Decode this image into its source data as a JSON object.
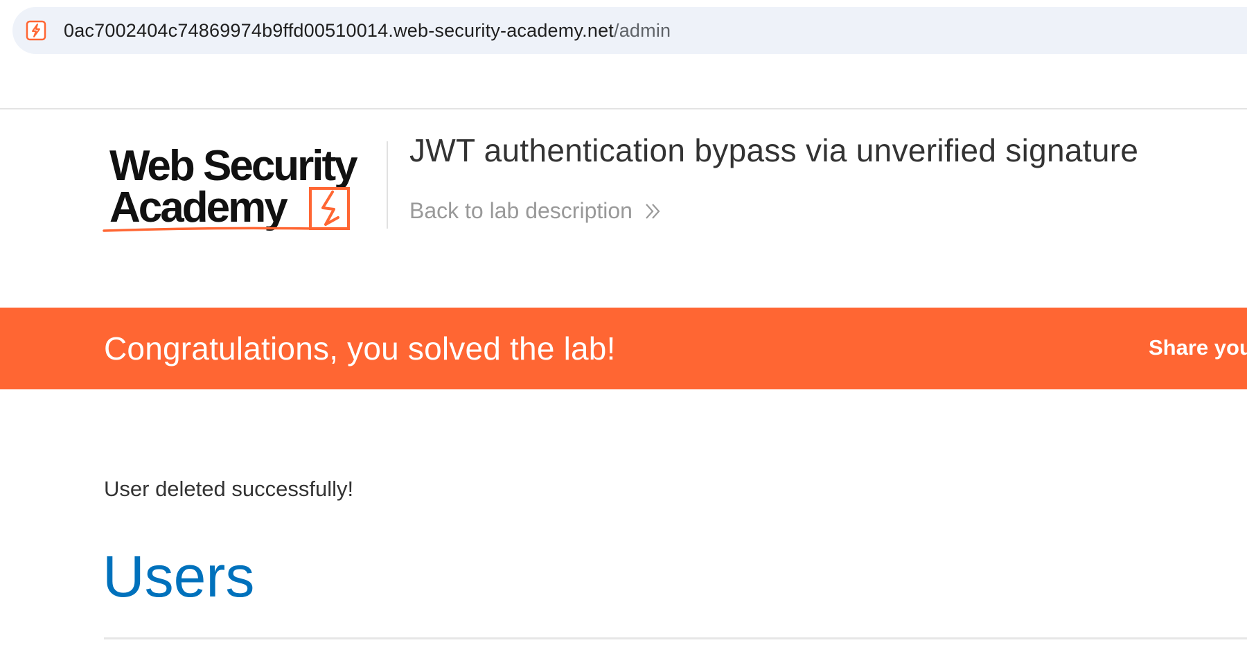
{
  "browser": {
    "url_host": "0ac7002404c74869974b9ffd00510014.web-security-academy.net",
    "url_path": "/admin",
    "site_icon": "lightning-favicon-icon"
  },
  "header": {
    "logo_text_line1": "Web Security",
    "logo_text_line2": "Academy",
    "lab_title": "JWT authentication bypass via unverified signature",
    "back_link_label": "Back to lab description",
    "back_link_icon": "double-chevron-right-icon"
  },
  "banner": {
    "solved_message": "Congratulations, you solved the lab!",
    "share_label": "Share you"
  },
  "main": {
    "flash_message": "User deleted successfully!",
    "heading": "Users"
  },
  "colors": {
    "accent_orange": "#ff6633",
    "heading_blue": "#0071bc",
    "url_bar_bg": "#eef2f9"
  }
}
